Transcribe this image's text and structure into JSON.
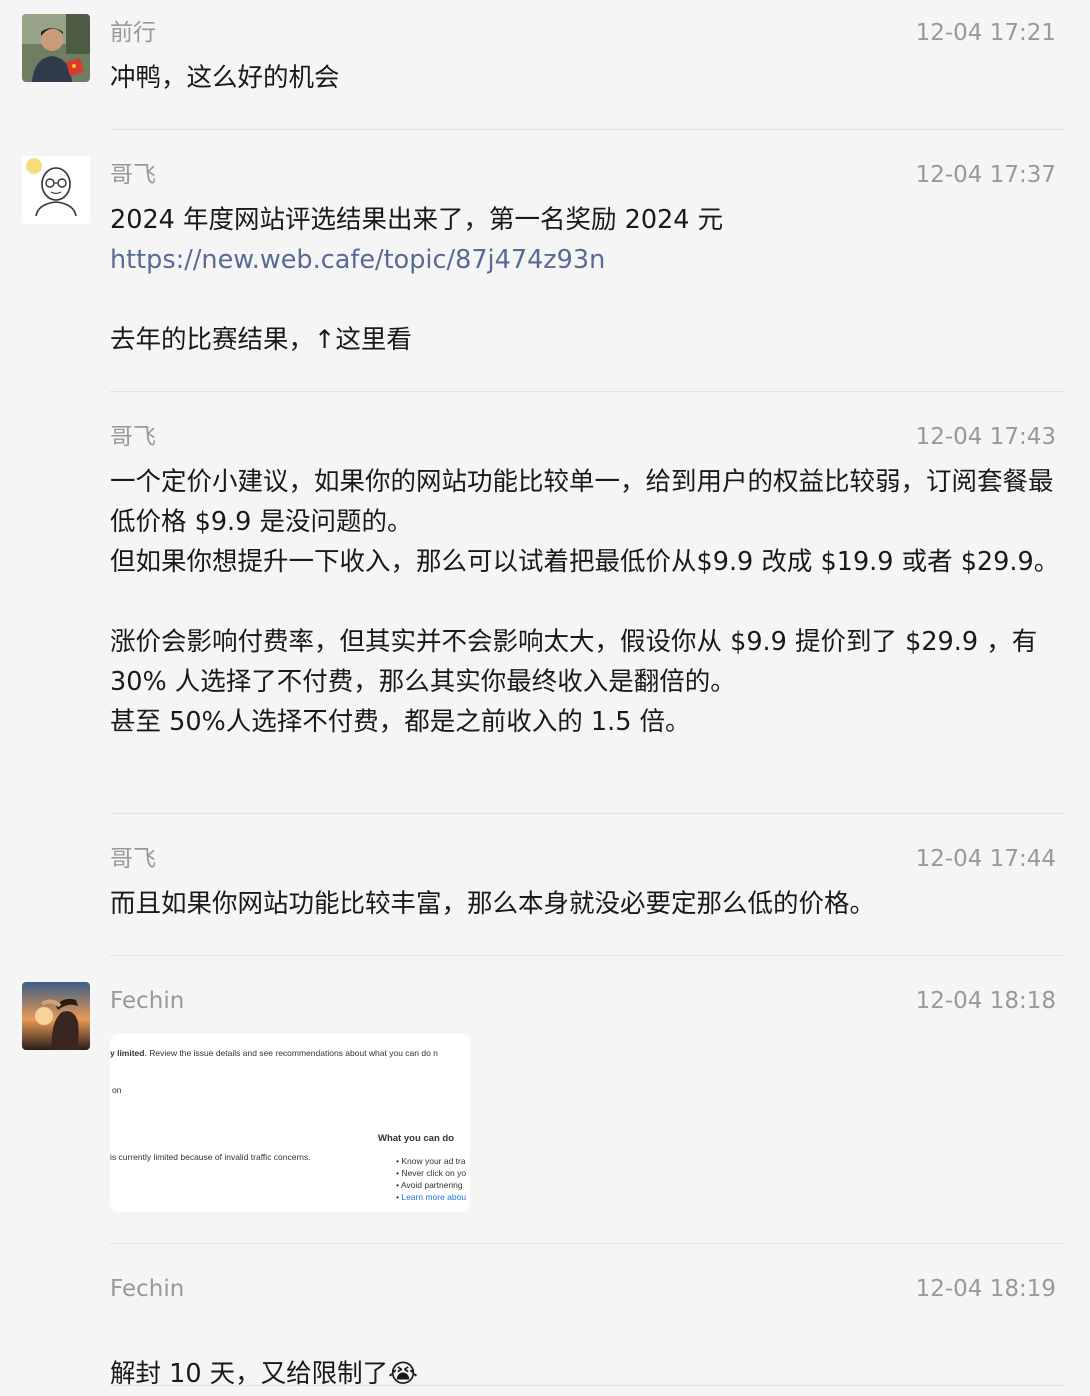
{
  "colors": {
    "background": "#f5f5f5",
    "name_text": "#999999",
    "body_text": "#191919",
    "link": "#576b95",
    "divider": "#e3e3e3"
  },
  "messages": [
    {
      "author": "前行",
      "time": "12-04 17:21",
      "text": "冲鸭，这么好的机会",
      "avatar_icon": "user-photo-avatar-icon"
    },
    {
      "author": "哥飞",
      "time": "12-04 17:37",
      "text_line1": "2024 年度网站评选结果出来了，第一名奖励 2024 元",
      "link": "https://new.web.cafe/topic/87j474z93n",
      "text_line3": "去年的比赛结果，↑这里看",
      "avatar_icon": "cartoon-avatar-icon"
    },
    {
      "author": "哥飞",
      "time": "12-04 17:43",
      "text": "一个定价小建议，如果你的网站功能比较单一，给到用户的权益比较弱，订阅套餐最低价格 $9.9 是没问题的。\n但如果你想提升一下收入，那么可以试着把最低价从$9.9 改成 $19.9 或者 $29.9。\n\n涨价会影响付费率，但其实并不会影响太大，假设你从 $9.9 提价到了 $29.9 ，有 30% 人选择了不付费，那么其实你最终收入是翻倍的。\n甚至 50%人选择不付费，都是之前收入的 1.5 倍。"
    },
    {
      "author": "哥飞",
      "time": "12-04 17:44",
      "text": "而且如果你网站功能比较丰富，那么本身就没必要定那么低的价格。"
    },
    {
      "author": "Fechin",
      "time": "12-04 18:18",
      "avatar_icon": "sunset-photo-avatar-icon",
      "image": {
        "line1_bold": "y limited",
        "line1_rest": ". Review the issue details and see recommendations about what you can do n",
        "line2": "on",
        "heading": "What you can do",
        "line3": "is currently limited because of invalid traffic concerns.",
        "bullets": [
          "Know your ad tra",
          "Never click on yo",
          "Avoid partnering"
        ],
        "learn_more": "Learn more abou"
      }
    },
    {
      "author": "Fechin",
      "time": "12-04 18:19",
      "text": "解封 10 天，又给限制了",
      "emoji": "😭"
    }
  ]
}
